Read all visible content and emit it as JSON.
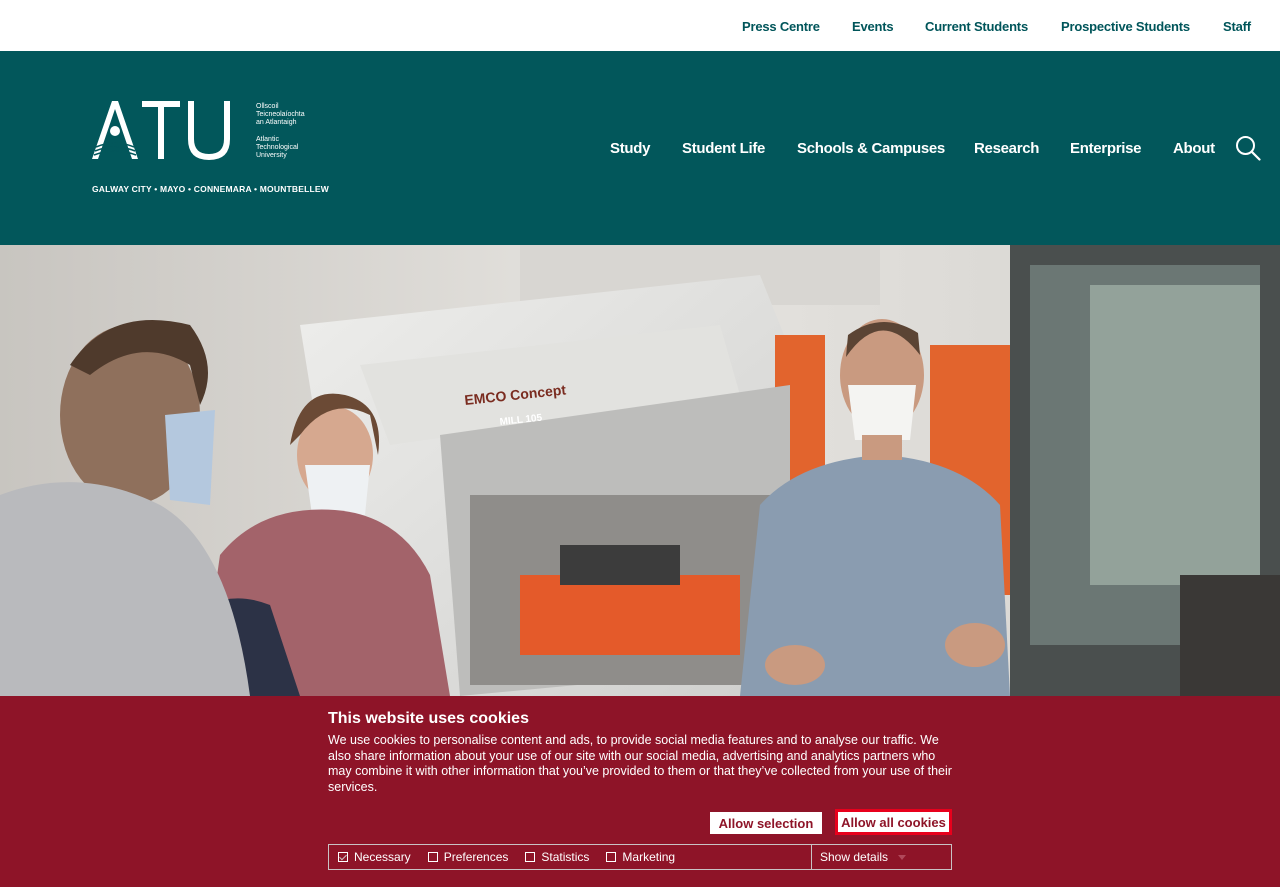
{
  "utility_nav": {
    "links": [
      "Press Centre",
      "Events",
      "Current Students",
      "Prospective Students",
      "Staff"
    ]
  },
  "header": {
    "logo_text": "ATU",
    "logo_irish": [
      "Ollscoil",
      "Teicneolaíochta",
      "an Atlantaigh"
    ],
    "logo_english": [
      "Atlantic",
      "Technological",
      "University"
    ],
    "campuses": "GALWAY CITY  •  MAYO  •  CONNEMARA  •  MOUNTBELLEW",
    "nav": [
      "Study",
      "Student Life",
      "Schools & Campuses",
      "Research",
      "Enterprise",
      "About"
    ],
    "search_icon": "search-icon"
  },
  "hero": {
    "machine_brand": "EMCO Concept",
    "machine_model": "MILL 105"
  },
  "cookie_banner": {
    "title": "This website uses cookies",
    "text": "We use cookies to personalise content and ads, to provide social media features and to analyse our traffic. We also share information about your use of our site with our social media, advertising and analytics partners who may combine it with other information that you’ve provided to them or that they’ve collected from your use of their services.",
    "allow_selection": "Allow selection",
    "allow_all": "Allow all cookies",
    "options": [
      {
        "label": "Necessary",
        "checked": true
      },
      {
        "label": "Preferences",
        "checked": false
      },
      {
        "label": "Statistics",
        "checked": false
      },
      {
        "label": "Marketing",
        "checked": false
      }
    ],
    "show_details": "Show details"
  },
  "colors": {
    "header_teal": "#02575b",
    "utility_text": "#00555a",
    "banner_red": "#8e1428",
    "focus_outline": "#e8001c"
  }
}
